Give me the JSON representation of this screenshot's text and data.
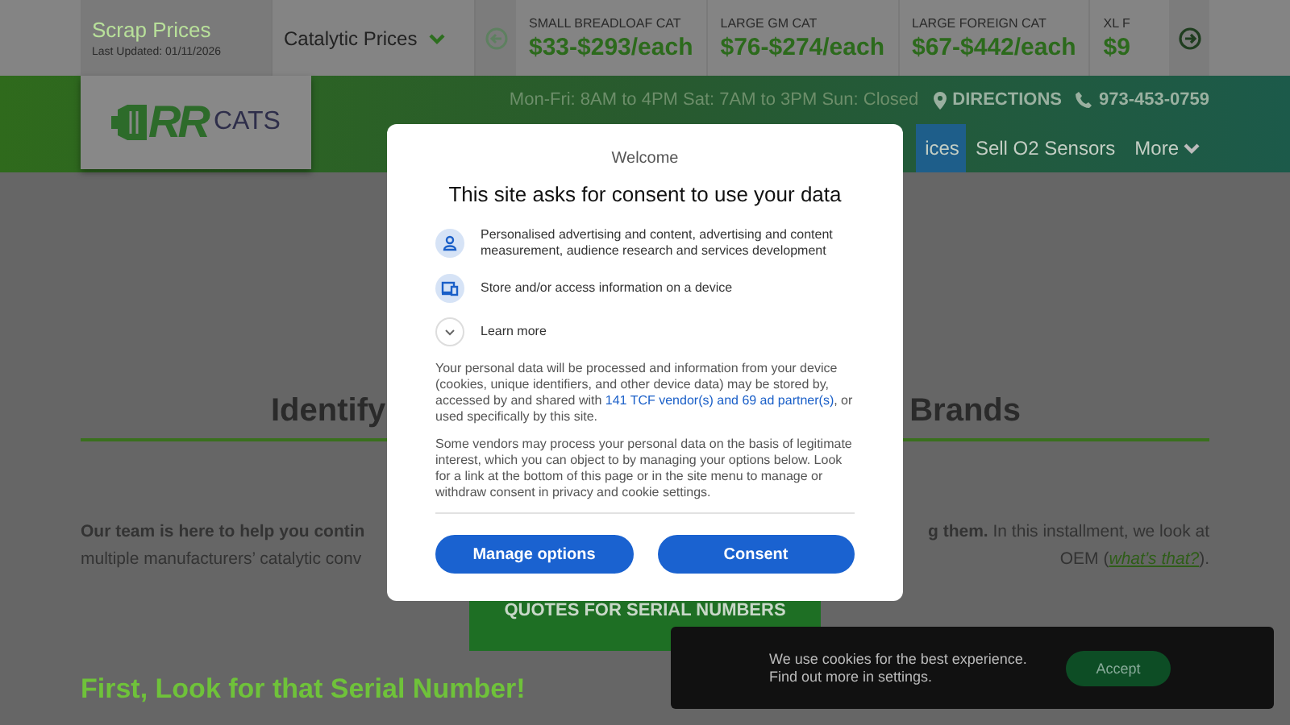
{
  "top_bar": {
    "scrap_title": "Scrap Prices",
    "last_updated": "Last Updated: 01/11/2026",
    "dropdown": "Catalytic Prices",
    "tickers": [
      {
        "label": "SMALL BREADLOAF CAT",
        "price": "$33-$293/each"
      },
      {
        "label": "LARGE GM CAT",
        "price": "$76-$274/each"
      },
      {
        "label": "LARGE FOREIGN CAT",
        "price": "$67-$442/each"
      },
      {
        "label": "XL F",
        "price": "$9"
      }
    ]
  },
  "header": {
    "logo": {
      "mark": "RR",
      "word": "CATS"
    },
    "hours": "Mon-Fri: 8AM to 4PM Sat: 7AM to 3PM Sun: Closed",
    "directions": "DIRECTIONS",
    "phone": "973-453-0759",
    "nav": [
      {
        "label": "ices",
        "selected": true
      },
      {
        "label": "Sell O2 Sensors",
        "selected": false
      },
      {
        "label": "More",
        "selected": false
      }
    ]
  },
  "content": {
    "heading_left": "Identify",
    "heading_right": "Brands",
    "intro_left": [
      "**Our team is here to help you contin**",
      "multiple manufacturers’ catalytic conv"
    ],
    "intro_right": "**g them.** In this installment, we look at",
    "intro_right_2": "OEM (",
    "intro_link": "what’s that?",
    "intro_right_3": ").",
    "quote_button": "QUOTES FOR SERIAL NUMBERS",
    "subheading": "First, Look for that Serial Number!"
  },
  "consent_dialog": {
    "welcome": "Welcome",
    "title": "This site asks for consent to use your data",
    "purposes": [
      {
        "kind": "person",
        "text": "Personalised advertising and content, advertising and content measurement, audience research and services development"
      },
      {
        "kind": "device",
        "text": "Store and/or access information on a device"
      },
      {
        "kind": "expand",
        "text": "Learn more"
      }
    ],
    "body_1_before": "Your personal data will be processed and information from your device (cookies, unique identifiers, and other device data) may be stored by, accessed by and shared with ",
    "body_1_link": "141 TCF vendor(s) and 69 ad partner(s)",
    "body_1_after": ", or used specifically by this site.",
    "body_2": "Some vendors may process your personal data on the basis of legitimate interest, which you can object to by managing your options below. Look for a link at the bottom of this page or in the site menu to manage or withdraw consent in privacy and cookie settings.",
    "buttons": [
      "Manage options",
      "Consent"
    ]
  },
  "cookie_bar": {
    "message": "We use cookies for the best experience. Find out more in settings.",
    "button": "Accept"
  }
}
